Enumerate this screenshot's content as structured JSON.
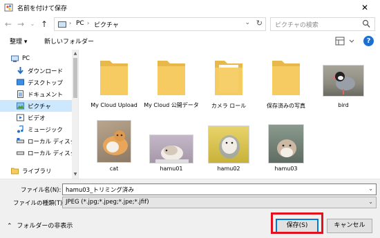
{
  "window": {
    "title": "名前を付けて保存",
    "close_glyph": "✕"
  },
  "address": {
    "crumbs": [
      "PC",
      "ピクチャ"
    ],
    "search_placeholder": "ピクチャの検索"
  },
  "toolbar": {
    "organize_label": "整理 ▾",
    "new_folder_label": "新しいフォルダー"
  },
  "sidebar": {
    "items": [
      {
        "label": "PC",
        "icon": "pc-icon"
      },
      {
        "label": "ダウンロード",
        "icon": "download-icon"
      },
      {
        "label": "デスクトップ",
        "icon": "desktop-icon"
      },
      {
        "label": "ドキュメント",
        "icon": "document-icon"
      },
      {
        "label": "ピクチャ",
        "icon": "picture-icon",
        "selected": true
      },
      {
        "label": "ビデオ",
        "icon": "video-icon"
      },
      {
        "label": "ミュージック",
        "icon": "music-icon"
      },
      {
        "label": "ローカル ディスク (C",
        "icon": "drive-icon"
      },
      {
        "label": "ローカル ディスク (D",
        "icon": "drive-icon"
      },
      {
        "label": "ライブラリ",
        "icon": "library-icon"
      }
    ]
  },
  "files": {
    "folders": [
      {
        "name": "My Cloud Upload"
      },
      {
        "name": "My Cloud 公開データ"
      },
      {
        "name": "カメラ ロール"
      },
      {
        "name": "保存済みの写真"
      }
    ],
    "images": [
      {
        "name": "bird"
      },
      {
        "name": "cat"
      },
      {
        "name": "hamu01"
      },
      {
        "name": "hamu02"
      },
      {
        "name": "hamu03"
      }
    ]
  },
  "form": {
    "filename_label": "ファイル名(N):",
    "filename_value": "hamu03_トリミング済み",
    "filetype_label": "ファイルの種類(T):",
    "filetype_value": "JPEG (*.jpg;*.jpeg;*.jpe;*.jfif)"
  },
  "footer": {
    "hide_folders_label": "フォルダーの非表示",
    "save_label": "保存(S)",
    "cancel_label": "キャンセル"
  },
  "colors": {
    "accent": "#0078d7",
    "selected_bg": "#cce8ff",
    "highlight": "#e3101e",
    "folder": "#f6cc62"
  }
}
